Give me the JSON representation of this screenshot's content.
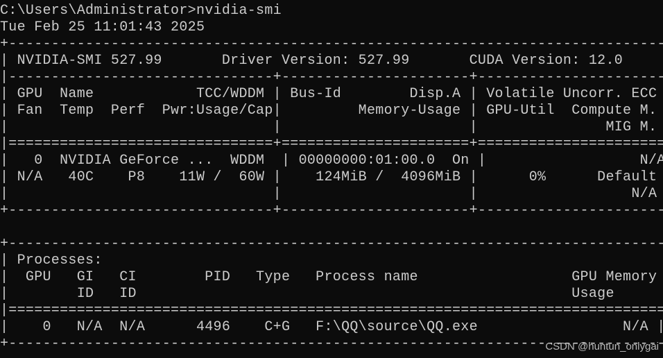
{
  "terminal": {
    "lines": [
      "C:\\Users\\Administrator>nvidia-smi",
      "Tue Feb 25 11:01:43 2025",
      "+-----------------------------------------------------------------------------+",
      "| NVIDIA-SMI 527.99       Driver Version: 527.99       CUDA Version: 12.0     |",
      "|-------------------------------+----------------------+----------------------+",
      "| GPU  Name            TCC/WDDM | Bus-Id        Disp.A | Volatile Uncorr. ECC |",
      "| Fan  Temp  Perf  Pwr:Usage/Cap|         Memory-Usage | GPU-Util  Compute M. |",
      "|                               |                      |               MIG M. |",
      "|===============================+======================+======================|",
      "|   0  NVIDIA GeForce ...  WDDM  | 00000000:01:00.0  On |                  N/A |",
      "| N/A   40C    P8    11W /  60W |    124MiB /  4096MiB |      0%      Default |",
      "|                               |                      |                  N/A |",
      "+-------------------------------+----------------------+----------------------+",
      "",
      "+-----------------------------------------------------------------------------+",
      "| Processes:                                                                  |",
      "|  GPU   GI   CI        PID   Type   Process name                  GPU Memory |",
      "|        ID   ID                                                   Usage      |",
      "|=============================================================================|",
      "|    0   N/A  N/A      4496    C+G   F:\\QQ\\source\\QQ.exe                 N/A |",
      "+-----------------------------------------------------------------------------+"
    ]
  },
  "watermark": "CSDN @huntun_onlygai"
}
